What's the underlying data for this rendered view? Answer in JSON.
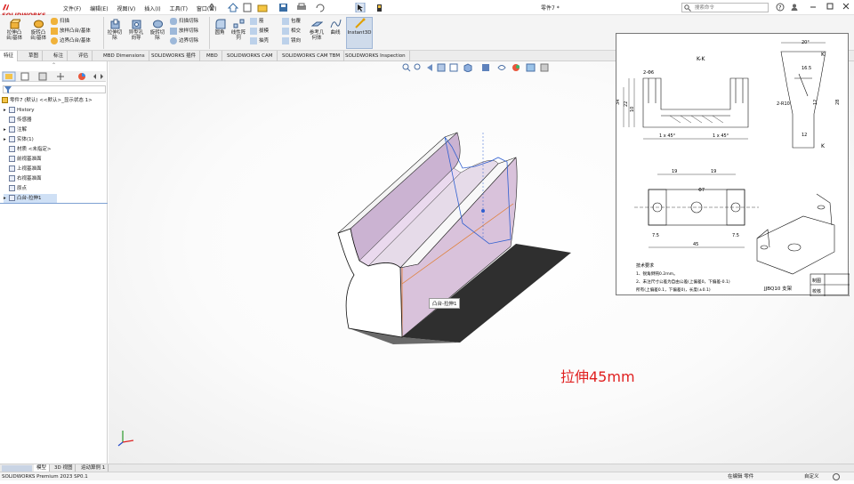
{
  "app": {
    "brand": "SOLIDWORKS",
    "doc_title": "零件7 *",
    "search_placeholder": "搜索命令",
    "menus": [
      "文件(F)",
      "编辑(E)",
      "视图(V)",
      "插入(I)",
      "工具(T)",
      "窗口(W)"
    ]
  },
  "ribbon": {
    "big_buttons": [
      {
        "label1": "拉伸凸",
        "label2": "台/基体"
      },
      {
        "label1": "旋转凸",
        "label2": "台/基体"
      },
      {
        "label1": "拉伸切",
        "label2": "除"
      },
      {
        "label1": "异型孔",
        "label2": "向导"
      },
      {
        "label1": "旋转切",
        "label2": "除"
      },
      {
        "label1": "线性阵",
        "label2": "列"
      },
      {
        "label1": "参考几",
        "label2": "何体"
      },
      {
        "label1": "曲线",
        "label2": ""
      },
      {
        "label1": "Instant3D",
        "label2": ""
      }
    ],
    "small_col1": [
      "扫描",
      "放样凸台/基体",
      "边界凸台/基体"
    ],
    "small_col2": [
      "扫描切除",
      "放样切除",
      "边界切除"
    ],
    "small_col3": [
      "圆角"
    ],
    "small_col4": [
      "筋",
      "拔模",
      "抽壳"
    ],
    "small_col5": [
      "包覆",
      "相交",
      "镜向"
    ]
  },
  "command_tabs": [
    "特征",
    "草图",
    "标注",
    "评估",
    "MBD Dimensions",
    "SOLIDWORKS 插件",
    "MBD",
    "SOLIDWORKS CAM",
    "SOLIDWORKS CAM TBM",
    "SOLIDWORKS Inspection"
  ],
  "feature_tree": {
    "root": "零件7 (默认) <<默认>_显示状态 1>",
    "items": [
      {
        "label": "History",
        "expander": "▸"
      },
      {
        "label": "传感器",
        "expander": ""
      },
      {
        "label": "注解",
        "expander": "▸"
      },
      {
        "label": "实体(1)",
        "expander": "▸"
      },
      {
        "label": "材质 <未指定>",
        "expander": ""
      },
      {
        "label": "前视基准面",
        "expander": ""
      },
      {
        "label": "上视基准面",
        "expander": ""
      },
      {
        "label": "右视基准面",
        "expander": ""
      },
      {
        "label": "原点",
        "expander": ""
      },
      {
        "label": "凸台-拉伸1",
        "expander": "▸"
      }
    ]
  },
  "viewport": {
    "tooltip": "凸台-拉伸1",
    "annotation": "拉伸45mm",
    "annotation_color": "#e02020",
    "model_face_color": "#d9c2db",
    "model_edge_highlight": "#e07a2a"
  },
  "drawing": {
    "section_label": "K-K",
    "dims_top": [
      "2-Φ6",
      "20°",
      "16.5",
      "K",
      "2-R10",
      "K",
      "10",
      "12",
      "28",
      "22",
      "34",
      "12",
      "1 x 45°",
      "1 x 45°"
    ],
    "dims_bottom": [
      "19",
      "19",
      "Φ7",
      "7.5",
      "45",
      "7.5"
    ],
    "notes_title": "技术要求",
    "notes": [
      "1、锐角倒钝0.2mm。",
      "2、未注尺寸公差为自由公差(上偏差0，下偏差-0.1)",
      "所有(上偏差0.1，下偏差0)，长度(±0.1)"
    ],
    "part_name": "JJBQ10 支架",
    "title_cells": [
      "制图",
      "校核"
    ]
  },
  "bottom_tabs": [
    "模型",
    "3D 视图",
    "运动算例 1"
  ],
  "status": {
    "left": "SOLIDWORKS Premium 2023 SP0.1",
    "mode": "在编辑 零件",
    "units": "自定义"
  }
}
